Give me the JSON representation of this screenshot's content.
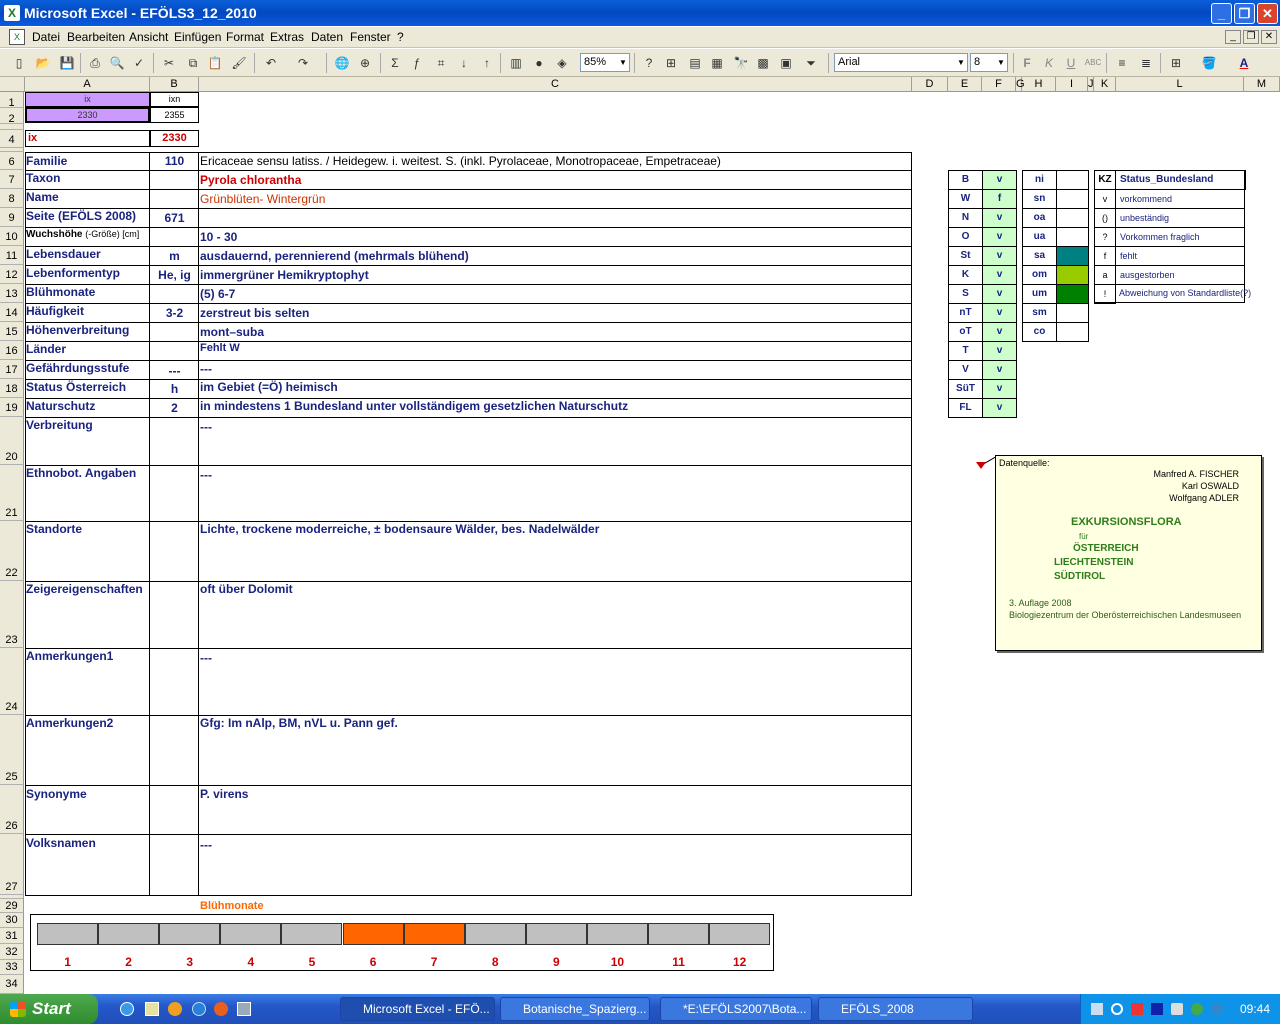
{
  "window": {
    "title": "Microsoft Excel - EFÖLS3_12_2010"
  },
  "menu": [
    "Datei",
    "Bearbeiten",
    "Ansicht",
    "Einfügen",
    "Format",
    "Extras",
    "Daten",
    "Fenster",
    "?"
  ],
  "toolbar": {
    "zoom": "85%",
    "font": "Arial",
    "size": "8",
    "bold": "F",
    "italic": "K",
    "underline": "U"
  },
  "columns": [
    "A",
    "B",
    "C",
    "D",
    "E",
    "F",
    "G",
    "H",
    "I",
    "J",
    "K",
    "L",
    "M"
  ],
  "rows": [
    "1",
    "2",
    "4",
    "6",
    "7",
    "8",
    "9",
    "10",
    "11",
    "12",
    "13",
    "14",
    "15",
    "16",
    "17",
    "18",
    "19",
    "20",
    "21",
    "22",
    "23",
    "24",
    "25",
    "26",
    "27",
    "29",
    "30",
    "31",
    "32",
    "33",
    "34"
  ],
  "top": {
    "a1": "ix",
    "b1": "ixn",
    "a2": "2330",
    "b2": "2355",
    "a4": "ix",
    "b4": "2330"
  },
  "fields": [
    {
      "label": "Familie",
      "val": "110",
      "text": "Ericaceae sensu latiss.  /  Heidegew. i. weitest. S. (inkl. Pyrolaceae, Monotropaceae, Empetraceae)"
    },
    {
      "label": "Taxon",
      "val": "",
      "text": "Pyrola chlorantha"
    },
    {
      "label": "Name",
      "val": "",
      "text": "Grünblüten- Wintergrün"
    },
    {
      "label": "Seite (EFÖLS 2008)",
      "val": "671",
      "text": ""
    },
    {
      "label": "Wuchshöhe",
      "label2": "(-Größe) [cm]",
      "val": "",
      "text": " 10 - 30"
    },
    {
      "label": "Lebensdauer",
      "val": "m",
      "text": "ausdauernd, perennierend (mehrmals blühend)"
    },
    {
      "label": "Lebenformentyp",
      "val": "He, ig",
      "text": "immergrüner Hemikryptophyt"
    },
    {
      "label": "Blühmonate",
      "val": "",
      "text": "(5) 6-7"
    },
    {
      "label": "Häufigkeit",
      "val": "3-2",
      "text": "zerstreut bis selten"
    },
    {
      "label": "Höhenverbreitung",
      "val": "",
      "text": "mont–suba"
    },
    {
      "label": "Länder",
      "val": "",
      "text": "Fehlt W"
    },
    {
      "label": "Gefährdungsstufe",
      "val": "---",
      "text": "  ---"
    },
    {
      "label": "Status Österreich",
      "val": "h",
      "text": "im Gebiet (=Ö) heimisch"
    },
    {
      "label": "Naturschutz",
      "val": "2",
      "text": "in mindestens 1 Bundesland unter vollständigem gesetzlichen Naturschutz"
    },
    {
      "label": "Verbreitung",
      "val": "",
      "text": " ---"
    },
    {
      "label": "Ethnobot. Angaben",
      "val": "",
      "text": "---"
    },
    {
      "label": "Standorte",
      "val": "",
      "text": "Lichte, trockene moderreiche, ± bodensaure Wälder, bes. Nadelwälder"
    },
    {
      "label": "Zeigereigenschaften",
      "val": "",
      "text": "oft über Dolomit"
    },
    {
      "label": "Anmerkungen1",
      "val": "",
      "text": "---"
    },
    {
      "label": "Anmerkungen2",
      "val": "",
      "text": "Gfg: Im nAlp, BM, nVL u. Pann gef."
    },
    {
      "label": "Synonyme",
      "val": "",
      "text": "P. virens"
    },
    {
      "label": "Volksnamen",
      "val": "",
      "text": "---"
    }
  ],
  "states": [
    {
      "k": "B",
      "v": "v"
    },
    {
      "k": "W",
      "v": "f"
    },
    {
      "k": "N",
      "v": "v"
    },
    {
      "k": "O",
      "v": "v"
    },
    {
      "k": "St",
      "v": "v"
    },
    {
      "k": "K",
      "v": "v"
    },
    {
      "k": "S",
      "v": "v"
    },
    {
      "k": "nT",
      "v": "v"
    },
    {
      "k": "oT",
      "v": "v"
    },
    {
      "k": "T",
      "v": "v"
    },
    {
      "k": "V",
      "v": "v"
    },
    {
      "k": "SüT",
      "v": "v"
    },
    {
      "k": "FL",
      "v": "v"
    }
  ],
  "zones": [
    {
      "k": "ni",
      "c": "#ffffff"
    },
    {
      "k": "sn",
      "c": "#ffffff"
    },
    {
      "k": "oa",
      "c": "#ffffff"
    },
    {
      "k": "ua",
      "c": "#ffffff"
    },
    {
      "k": "sa",
      "c": "#008080"
    },
    {
      "k": "om",
      "c": "#99cc00"
    },
    {
      "k": "um",
      "c": "#008000"
    },
    {
      "k": "sm",
      "c": "#ffffff"
    },
    {
      "k": "co",
      "c": "#ffffff"
    }
  ],
  "legend": {
    "head_k": "KZ",
    "head_t": "Status_Bundesland",
    "items": [
      {
        "k": "v",
        "t": "vorkommend"
      },
      {
        "k": "()",
        "t": "unbeständig"
      },
      {
        "k": "?",
        "t": "Vorkommen fraglich"
      },
      {
        "k": "f",
        "t": "fehlt"
      },
      {
        "k": "a",
        "t": "ausgestorben"
      },
      {
        "k": "!",
        "t": "Abweichung von Standardliste(?)"
      }
    ]
  },
  "note": {
    "source": "Datenquelle:",
    "authors": [
      "Manfred A. FISCHER",
      "Karl OSWALD",
      "Wolfgang ADLER"
    ],
    "title1": "EXKURSIONSFLORA",
    "fuer": "für",
    "t2": "ÖSTERREICH",
    "t3": "LIECHTENSTEIN",
    "t4": "SÜDTIROL",
    "ed": "3. Auflage 2008",
    "pub": "Biologiezentrum der Oberösterreichischen Landesmuseen"
  },
  "bloom": {
    "title": "Blühmonate",
    "months": [
      "1",
      "2",
      "3",
      "4",
      "5",
      "6",
      "7",
      "8",
      "9",
      "10",
      "11",
      "12"
    ],
    "active": [
      6,
      7
    ],
    "active_color": "#ff6600",
    "inactive_color": "#c0c0c0"
  },
  "taskbar": {
    "start": "Start",
    "tasks": [
      "Microsoft Excel - EFÖ...",
      "Botanische_Spazierg...",
      "*E:\\EFÖLS2007\\Bota...",
      "EFÖLS_2008"
    ],
    "clock": "09:44"
  }
}
